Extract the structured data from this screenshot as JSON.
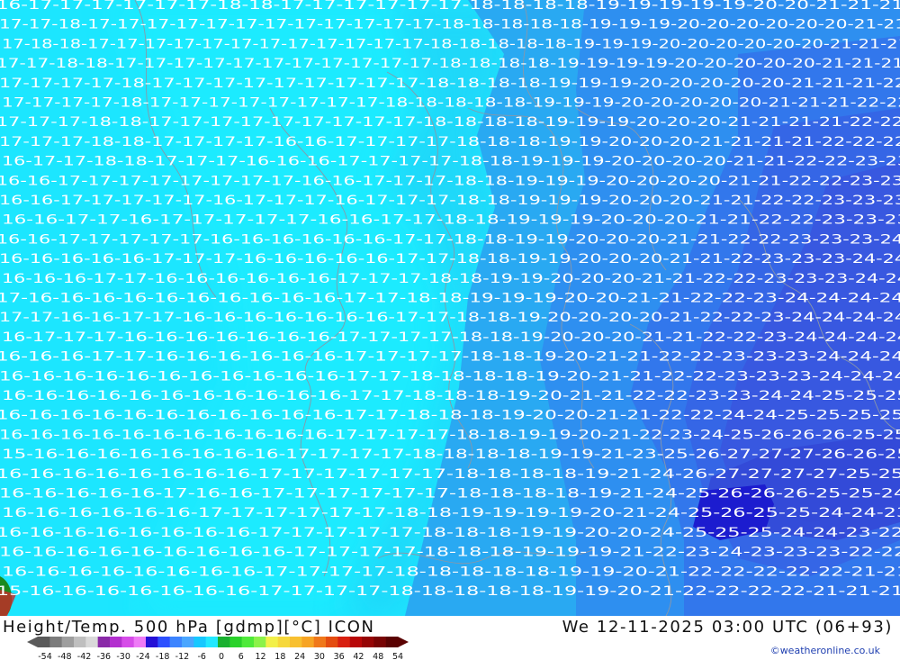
{
  "map": {
    "product": "Height/Temp. 500 hPa [gdmp][°C] ICON",
    "valid_time": "We 12-11-2025 03:00 UTC (06+93)",
    "credit": "©weatheronline.co.uk",
    "legend": {
      "ticks": [
        "-54",
        "-48",
        "-42",
        "-36",
        "-30",
        "-24",
        "-18",
        "-12",
        "-6",
        "0",
        "6",
        "12",
        "18",
        "24",
        "30",
        "36",
        "42",
        "48",
        "54"
      ],
      "colors": [
        "#5a5a5a",
        "#7c7c7c",
        "#9e9e9e",
        "#bfbfbf",
        "#d9d9d9",
        "#8a2aa8",
        "#b32fcf",
        "#d64ce8",
        "#ee7af6",
        "#2410d6",
        "#2d50ff",
        "#3c84ff",
        "#4aa6ff",
        "#17c8ff",
        "#22e8ff",
        "#1ab030",
        "#2ad22a",
        "#4fea3a",
        "#8cf24a",
        "#f2f04a",
        "#f6d83c",
        "#f8c030",
        "#f7a424",
        "#f0781a",
        "#e44c10",
        "#d82010",
        "#b80808",
        "#960606",
        "#780404",
        "#5a0202"
      ]
    },
    "isotherm_rows": [
      "16 17 17 17 17 17 17 18 18 17 17 17 17 17 17 18 18 18 18 19 19 19 19 19 20 20 21 21 21",
      "17 17 18 17 17 17 17 17 17 17 17 17 17 17 17 18 18 18 18 18 19 19 19 20 20 20 20 20 20 21 21",
      "17 18 18 17 17 17 17 17 17 17 17 17 17 17 17 18 18 18 18 18 19 19 19 20 20 20 20 20 20 21 21 21",
      "17 17 18 18 17 17 17 17 17 17 17 17 17 17 17 18 18 18 18 19 19 19 19 20 20 20 20 20 21 21 21",
      "17 17 17 17 18 17 17 17 17 17 17 17 17 17 18 18 18 18 19 19 19 20 20 20 20 20 21 21 21 22",
      "17 17 17 17 18 17 17 17 17 17 17 17 17 18 18 18 18 18 19 19 19 20 20 20 20 20 21 21 21 22 22",
      "17 17 17 18 18 17 17 17 17 17 17 17 17 17 18 18 18 18 19 19 19 20 20 20 21 21 21 21 22 22",
      "17 17 17 18 18 17 17 17 17 16 16 17 17 17 17 18 18 18 19 19 20 20 20 21 21 21 21 22 22 22",
      "16 17 17 18 18 17 17 17 16 16 16 17 17 17 17 18 18 19 19 19 20 20 20 20 21 21 22 22 23 23",
      "16 16 17 17 17 17 17 17 17 17 16 16 17 17 17 18 18 19 19 19 20 20 20 20 21 21 22 22 23 23",
      "16 16 17 17 17 17 17 16 17 17 17 16 17 17 17 18 18 19 19 19 20 20 20 21 21 22 22 23 23 23",
      "16 16 17 17 16 17 17 17 17 17 16 16 17 17 18 18 19 19 19 20 20 20 21 21 22 22 23 23 23",
      "16 16 17 17 17 17 17 16 16 16 16 16 16 17 17 18 18 19 19 20 20 20 21 21 22 22 23 23 23 24",
      "16 16 16 16 16 17 17 17 16 16 16 16 16 17 17 18 18 19 19 20 20 20 21 21 22 23 23 23 24 24",
      "16 16 16 17 17 16 16 16 16 16 16 17 17 17 18 18 19 19 20 20 20 21 21 22 22 23 23 23 24 24",
      "17 16 16 16 16 16 16 16 16 16 16 17 17 18 18 19 19 19 20 20 21 21 22 22 23 24 24 24 24",
      "17 17 16 16 17 17 16 16 16 16 16 16 16 17 17 18 18 19 20 20 20 20 21 22 22 23 24 24 24 24",
      "16 17 17 17 16 16 16 16 16 16 16 17 17 17 17 18 18 19 20 20 20 21 21 22 22 23 24 24 24 24",
      "16 16 16 17 17 16 16 16 16 16 16 17 17 17 17 18 18 19 20 21 21 22 22 23 23 23 24 24 24",
      "16 16 16 16 16 16 16 16 16 16 16 17 17 18 18 18 18 19 20 21 21 22 22 23 23 23 24 24 24",
      "16 16 16 16 16 16 16 16 16 16 16 17 17 18 18 18 19 20 21 21 22 22 23 23 24 24 25 25 25",
      "16 16 16 16 16 16 16 16 16 16 16 17 17 18 18 18 19 20 20 21 21 22 22 24 24 25 25 25 25",
      "16 16 16 16 16 16 16 16 16 16 16 17 17 17 17 18 18 19 19 20 21 22 23 24 25 26 26 26 25 25",
      "15 16 16 16 16 16 16 16 16 17 17 17 17 18 18 18 18 19 19 21 23 25 26 27 27 27 26 26 25",
      "16 16 16 16 16 16 16 16 17 17 17 17 17 17 18 18 18 18 19 21 24 26 27 27 27 27 25 25",
      "16 16 16 16 16 17 16 16 17 17 17 17 17 17 18 18 18 18 19 21 24 25 26 26 26 25 25 24",
      "16 16 16 16 16 16 17 17 17 17 17 17 18 18 19 19 19 19 20 21 24 25 26 25 25 24 24 23",
      "16 16 16 16 16 16 16 16 17 17 17 17 17 18 18 18 19 19 20 20 24 25 25 25 24 24 23 22",
      "16 16 16 16 16 16 16 16 16 17 17 17 17 18 18 18 19 19 19 21 22 23 24 23 23 23 22 22",
      "16 16 16 16 16 16 16 16 17 17 17 17 18 18 18 18 18 19 19 20 21 22 22 22 22 22 21 21",
      "15 16 16 16 16 16 16 16 17 17 17 17 18 18 18 18 18 19 19 20 21 22 22 22 22 21 21 21"
    ]
  }
}
